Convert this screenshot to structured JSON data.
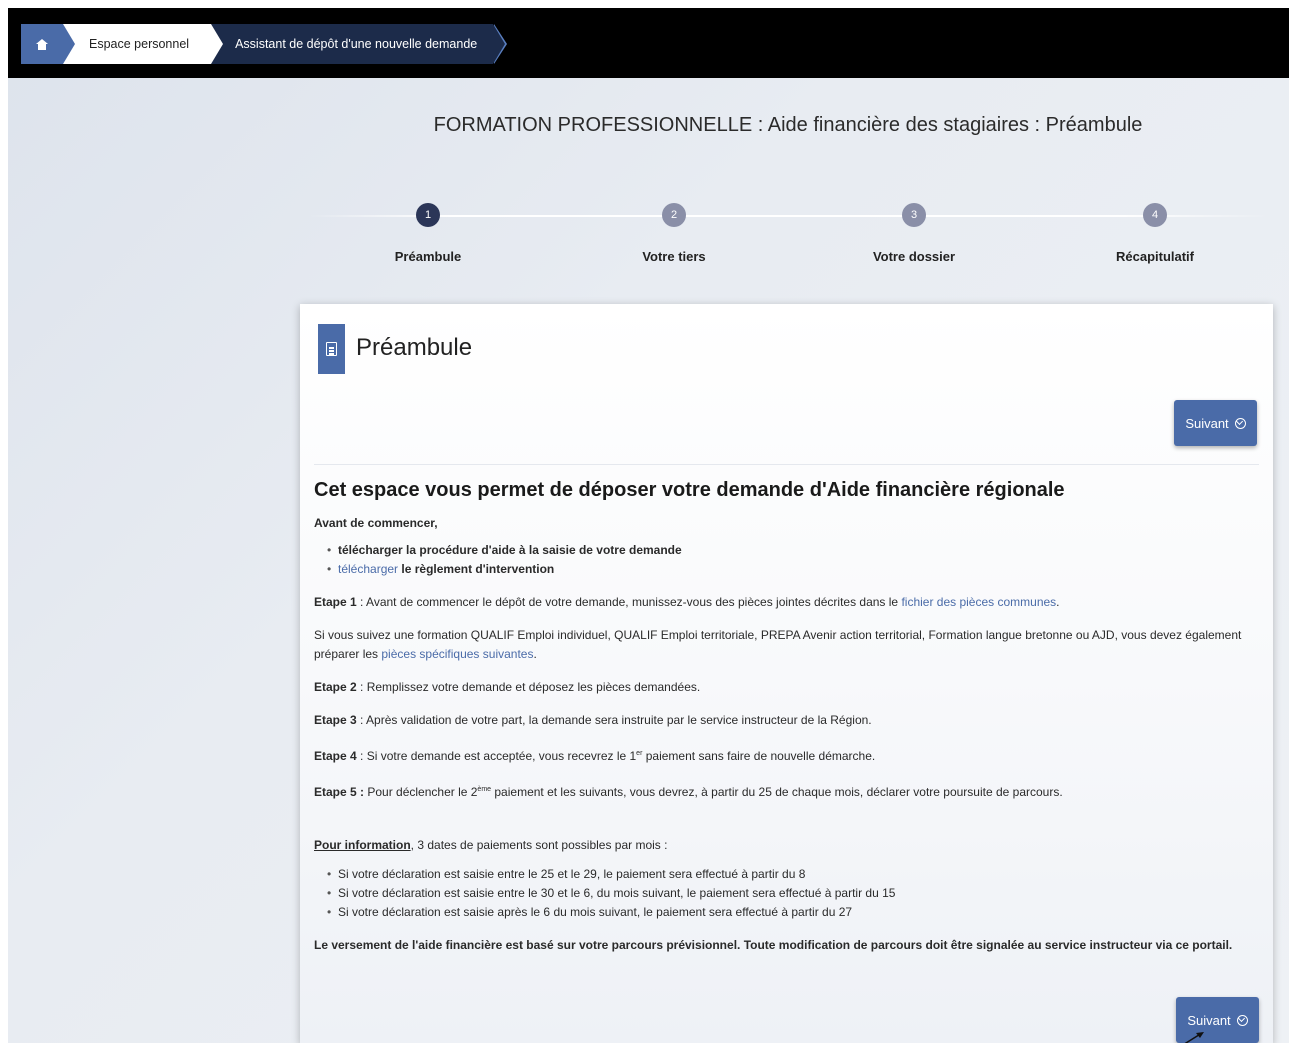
{
  "breadcrumb": {
    "home_icon": "home-icon",
    "items": [
      "Espace personnel",
      "Assistant de dépôt d'une nouvelle demande"
    ]
  },
  "page": {
    "title": "FORMATION PROFESSIONNELLE : Aide financière des stagiaires : Préambule"
  },
  "stepper": {
    "steps": [
      {
        "number": "1",
        "label": "Préambule",
        "active": true
      },
      {
        "number": "2",
        "label": "Votre tiers",
        "active": false
      },
      {
        "number": "3",
        "label": "Votre dossier",
        "active": false
      },
      {
        "number": "4",
        "label": "Récapitulatif",
        "active": false
      }
    ]
  },
  "card": {
    "icon": "document-icon",
    "title": "Préambule",
    "next_label": "Suivant",
    "heading": "Cet espace vous permet de déposer votre demande d'Aide financière régionale",
    "intro": "Avant de commencer,",
    "prelist": [
      {
        "link": "",
        "bold": "télécharger la procédure d'aide à la saisie de votre demande"
      },
      {
        "link": "télécharger",
        "bold": " le règlement d'intervention"
      }
    ],
    "etape1_label": "Etape 1",
    "etape1_text": " : Avant de commencer le dépôt de votre demande, munissez-vous des pièces jointes décrites dans le ",
    "etape1_link": "fichier des pièces communes",
    "etape1_end": ".",
    "qualif_text": "Si vous suivez une formation QUALIF Emploi individuel, QUALIF Emploi territoriale, PREPA Avenir action territorial, Formation langue bretonne ou AJD, vous devez également préparer les ",
    "qualif_link": "pièces spécifiques suivantes",
    "qualif_end": ".",
    "etape2_label": "Etape 2",
    "etape2_text": " : Remplissez votre demande et déposez les pièces demandées.",
    "etape3_label": "Etape 3",
    "etape3_text": " : Après validation de votre part, la demande sera instruite par le service instructeur de la Région.",
    "etape4_label": "Etape 4",
    "etape4_text_a": " : Si votre demande est acceptée, vous recevrez le 1",
    "etape4_sup": "er",
    "etape4_text_b": " paiement sans faire de nouvelle démarche.",
    "etape5_label": "Etape 5 :",
    "etape5_text_a": " Pour déclencher le 2",
    "etape5_sup": "ème",
    "etape5_text_b": " paiement et les suivants, vous devrez, à partir du 25 de chaque mois, déclarer votre poursuite de parcours.",
    "info_label": "Pour information",
    "info_text": ", 3 dates de paiements sont possibles par mois :",
    "info_list": [
      "Si votre déclaration est saisie entre le 25 et le 29, le paiement sera effectué à partir du 8",
      "Si votre déclaration est saisie entre le 30 et le 6, du mois suivant, le paiement sera effectué à partir du 15",
      "Si votre déclaration est saisie après le 6 du mois suivant, le paiement sera effectué à partir du 27"
    ],
    "closing": "Le versement de l'aide financière est basé sur votre parcours prévisionnel. Toute modification de parcours doit être signalée au service instructeur via ce portail."
  },
  "colors": {
    "accent": "#4a6ba8",
    "active_step": "#2b3658",
    "inactive_step": "#8a8fa8",
    "topbar": "#000000"
  }
}
